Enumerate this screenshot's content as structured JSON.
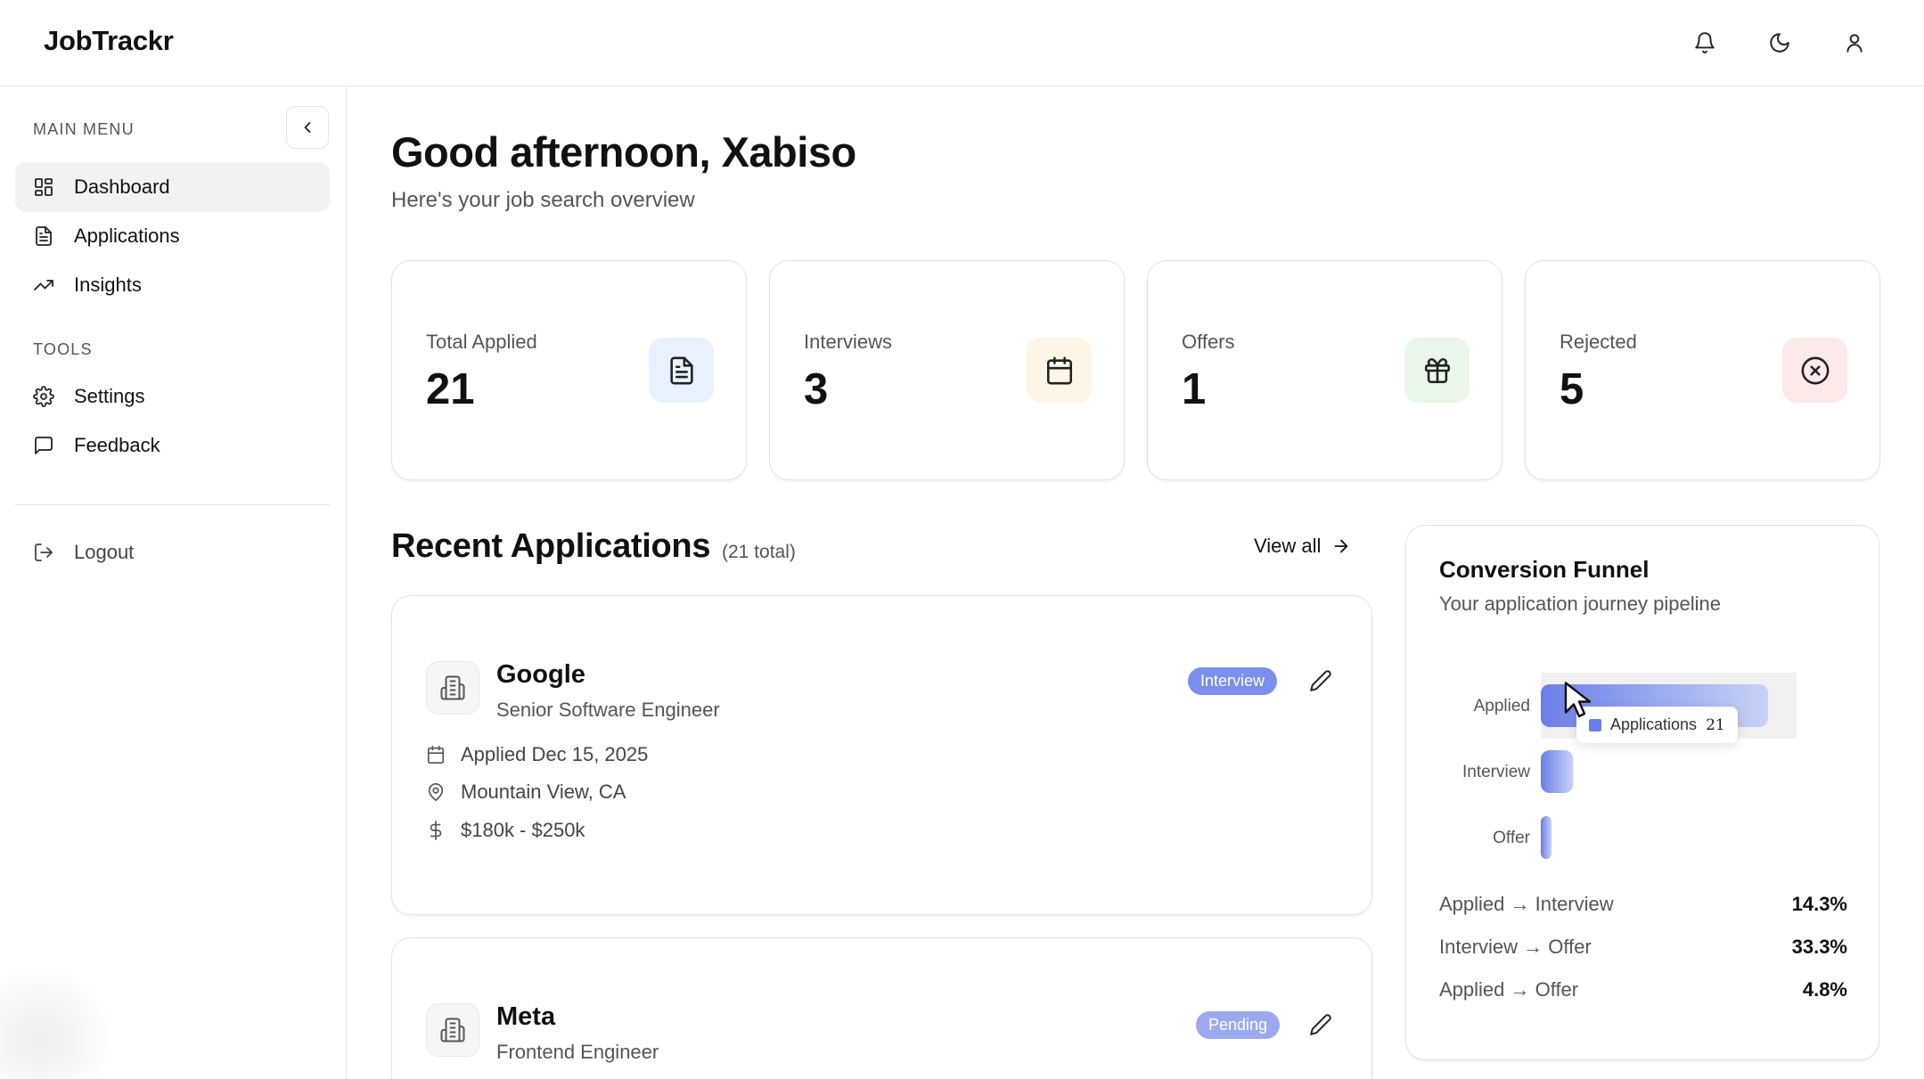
{
  "app": {
    "brand": "JobTrackr"
  },
  "header": {
    "icons": [
      "bell-icon",
      "moon-icon",
      "user-icon"
    ]
  },
  "sidebar": {
    "main_menu_label": "MAIN MENU",
    "tools_label": "TOOLS",
    "main_items": [
      {
        "label": "Dashboard",
        "icon": "grid-icon",
        "active": true
      },
      {
        "label": "Applications",
        "icon": "document-icon",
        "active": false
      },
      {
        "label": "Insights",
        "icon": "trend-icon",
        "active": false
      }
    ],
    "tool_items": [
      {
        "label": "Settings",
        "icon": "gear-icon"
      },
      {
        "label": "Feedback",
        "icon": "message-icon"
      }
    ],
    "logout_label": "Logout"
  },
  "main": {
    "greeting": "Good afternoon, Xabiso",
    "subtitle": "Here's your job search overview",
    "stats": [
      {
        "label": "Total Applied",
        "value": "21",
        "icon": "document-icon",
        "bg": "#e8f1fd"
      },
      {
        "label": "Interviews",
        "value": "3",
        "icon": "calendar-icon",
        "bg": "#fdf5e6"
      },
      {
        "label": "Offers",
        "value": "1",
        "icon": "gift-icon",
        "bg": "#e9f6e9"
      },
      {
        "label": "Rejected",
        "value": "5",
        "icon": "x-circle-icon",
        "bg": "#fce9ea"
      }
    ],
    "recent": {
      "title": "Recent Applications",
      "count": "(21 total)",
      "view_all": "View all",
      "items": [
        {
          "company": "Google",
          "role": "Senior Software Engineer",
          "status": "Interview",
          "status_color": "#7b8fec",
          "applied": "Applied Dec 15, 2025",
          "location": "Mountain View, CA",
          "salary": "$180k - $250k"
        },
        {
          "company": "Meta",
          "role": "Frontend Engineer",
          "status": "Pending",
          "status_color": "#9aa9f0"
        }
      ]
    },
    "funnel": {
      "title": "Conversion Funnel",
      "subtitle": "Your application journey pipeline",
      "tooltip": {
        "series": "Applications",
        "value": "21"
      },
      "rates": [
        {
          "label": "Applied → Interview",
          "value": "14.3%"
        },
        {
          "label": "Interview → Offer",
          "value": "33.3%"
        },
        {
          "label": "Applied → Offer",
          "value": "4.8%"
        }
      ]
    }
  },
  "chart_data": {
    "type": "bar",
    "orientation": "horizontal",
    "categories": [
      "Applied",
      "Interview",
      "Offer"
    ],
    "series": [
      {
        "name": "Applications",
        "values": [
          21,
          3,
          1
        ]
      }
    ],
    "xlim": [
      0,
      21
    ],
    "grid": false,
    "colors": [
      "#6b7ee8",
      "#c9d2f7"
    ]
  }
}
